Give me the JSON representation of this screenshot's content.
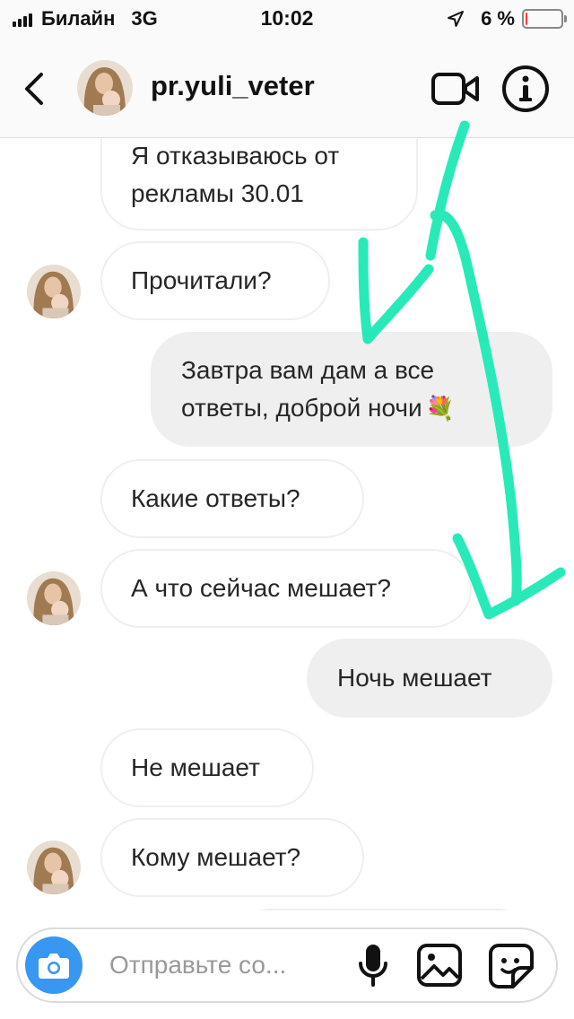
{
  "status_bar": {
    "carrier": "Билайн",
    "network": "3G",
    "time": "10:02",
    "battery_percent": "6 %",
    "battery_level": 0.06,
    "battery_color": "#ff3b30"
  },
  "header": {
    "username": "pr.yuli_veter",
    "back_icon": "chevron-left-icon",
    "video_icon": "video-camera-icon",
    "info_icon": "info-icon"
  },
  "messages": [
    {
      "direction": "in",
      "lines": [
        "Я отказываюсь от",
        "рекламы 30.01"
      ],
      "avatar": false
    },
    {
      "direction": "in",
      "text": "Прочитали?",
      "avatar": true
    },
    {
      "direction": "out",
      "lines": [
        "Завтра вам дам а все",
        "ответы, доброй ночи"
      ],
      "emoji": "💐"
    },
    {
      "direction": "in",
      "text": "Какие ответы?",
      "avatar": false
    },
    {
      "direction": "in",
      "text": "А что сейчас мешает?",
      "avatar": true
    },
    {
      "direction": "out",
      "text": "Ночь мешает"
    },
    {
      "direction": "in",
      "text": "Не мешает",
      "avatar": false
    },
    {
      "direction": "in",
      "text": "Кому мешает?",
      "avatar": true
    }
  ],
  "composer": {
    "placeholder": "Отправьте со...",
    "camera_icon": "camera-icon",
    "mic_icon": "microphone-icon",
    "gallery_icon": "gallery-icon",
    "sticker_icon": "sticker-icon",
    "accent_color": "#3897f0"
  },
  "annotation": {
    "color": "#1de9b6"
  }
}
